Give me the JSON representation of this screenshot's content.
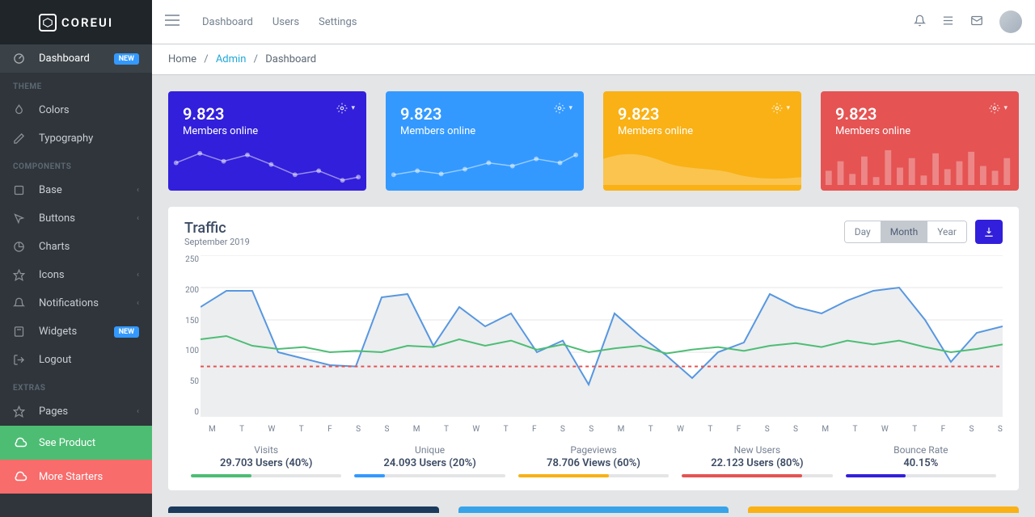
{
  "brand": "COREUI",
  "sidebar": {
    "dashboard": {
      "label": "Dashboard",
      "badge": "NEW"
    },
    "sections": [
      {
        "title": "THEME",
        "items": [
          {
            "label": "Colors",
            "icon": "drop"
          },
          {
            "label": "Typography",
            "icon": "pencil"
          }
        ]
      },
      {
        "title": "COMPONENTS",
        "items": [
          {
            "label": "Base",
            "icon": "puzzle",
            "chevron": true
          },
          {
            "label": "Buttons",
            "icon": "cursor",
            "chevron": true
          },
          {
            "label": "Charts",
            "icon": "pie"
          },
          {
            "label": "Icons",
            "icon": "star",
            "chevron": true
          },
          {
            "label": "Notifications",
            "icon": "bell",
            "chevron": true
          },
          {
            "label": "Widgets",
            "icon": "calc",
            "badge": "NEW"
          },
          {
            "label": "Logout",
            "icon": "logout"
          }
        ]
      },
      {
        "title": "EXTRAS",
        "items": [
          {
            "label": "Pages",
            "icon": "star",
            "chevron": true
          }
        ]
      }
    ],
    "buttons": [
      {
        "label": "See Product",
        "color": "green"
      },
      {
        "label": "More Starters",
        "color": "red"
      }
    ]
  },
  "header": {
    "nav": [
      "Dashboard",
      "Users",
      "Settings"
    ]
  },
  "breadcrumb": {
    "home": "Home",
    "admin": "Admin",
    "dashboard": "Dashboard"
  },
  "stats": [
    {
      "value": "9.823",
      "label": "Members online",
      "color": "blue"
    },
    {
      "value": "9.823",
      "label": "Members online",
      "color": "sky"
    },
    {
      "value": "9.823",
      "label": "Members online",
      "color": "orange"
    },
    {
      "value": "9.823",
      "label": "Members online",
      "color": "red"
    }
  ],
  "traffic": {
    "title": "Traffic",
    "sub": "September 2019",
    "seg": [
      "Day",
      "Month",
      "Year"
    ],
    "seg_active": "Month",
    "metrics": [
      {
        "title": "Visits",
        "val": "29.703 Users (40%)",
        "pct": 40,
        "color": "#4dbd74"
      },
      {
        "title": "Unique",
        "val": "24.093 Users (20%)",
        "pct": 20,
        "color": "#39f"
      },
      {
        "title": "Pageviews",
        "val": "78.706 Views (60%)",
        "pct": 60,
        "color": "#f9b115"
      },
      {
        "title": "New Users",
        "val": "22.123 Users (80%)",
        "pct": 80,
        "color": "#e55353"
      },
      {
        "title": "Bounce Rate",
        "val": "40.15%",
        "pct": 40,
        "color": "#321fdb"
      }
    ]
  },
  "chart_data": {
    "type": "line",
    "title": "Traffic",
    "xlabel": "",
    "ylabel": "",
    "ylim": [
      0,
      250
    ],
    "y_ticks": [
      250,
      200,
      150,
      100,
      50,
      0
    ],
    "categories": [
      "M",
      "T",
      "W",
      "T",
      "F",
      "S",
      "S",
      "M",
      "T",
      "W",
      "T",
      "F",
      "S",
      "S",
      "M",
      "T",
      "W",
      "T",
      "F",
      "S",
      "S",
      "M",
      "T",
      "W",
      "T",
      "F",
      "S",
      "S"
    ],
    "series": [
      {
        "name": "Visits",
        "color": "#5797e0",
        "fill": "#e4e5e6",
        "values": [
          170,
          195,
          195,
          100,
          90,
          80,
          78,
          185,
          190,
          110,
          170,
          140,
          160,
          100,
          118,
          50,
          160,
          125,
          95,
          60,
          100,
          115,
          190,
          170,
          160,
          180,
          195,
          200,
          150,
          85,
          130,
          140
        ]
      },
      {
        "name": "Unique",
        "color": "#4dbd74",
        "values": [
          120,
          125,
          110,
          105,
          108,
          100,
          102,
          100,
          110,
          108,
          120,
          110,
          118,
          104,
          112,
          100,
          106,
          110,
          98,
          104,
          108,
          102,
          110,
          114,
          108,
          118,
          112,
          118,
          108,
          100,
          105,
          112
        ]
      },
      {
        "name": "Baseline",
        "color": "#e55353",
        "dashed": true,
        "values": [
          78,
          78,
          78,
          78,
          78,
          78,
          78,
          78,
          78,
          78,
          78,
          78,
          78,
          78,
          78,
          78,
          78,
          78,
          78,
          78,
          78,
          78,
          78,
          78,
          78,
          78,
          78,
          78,
          78,
          78,
          78,
          78
        ]
      }
    ]
  }
}
